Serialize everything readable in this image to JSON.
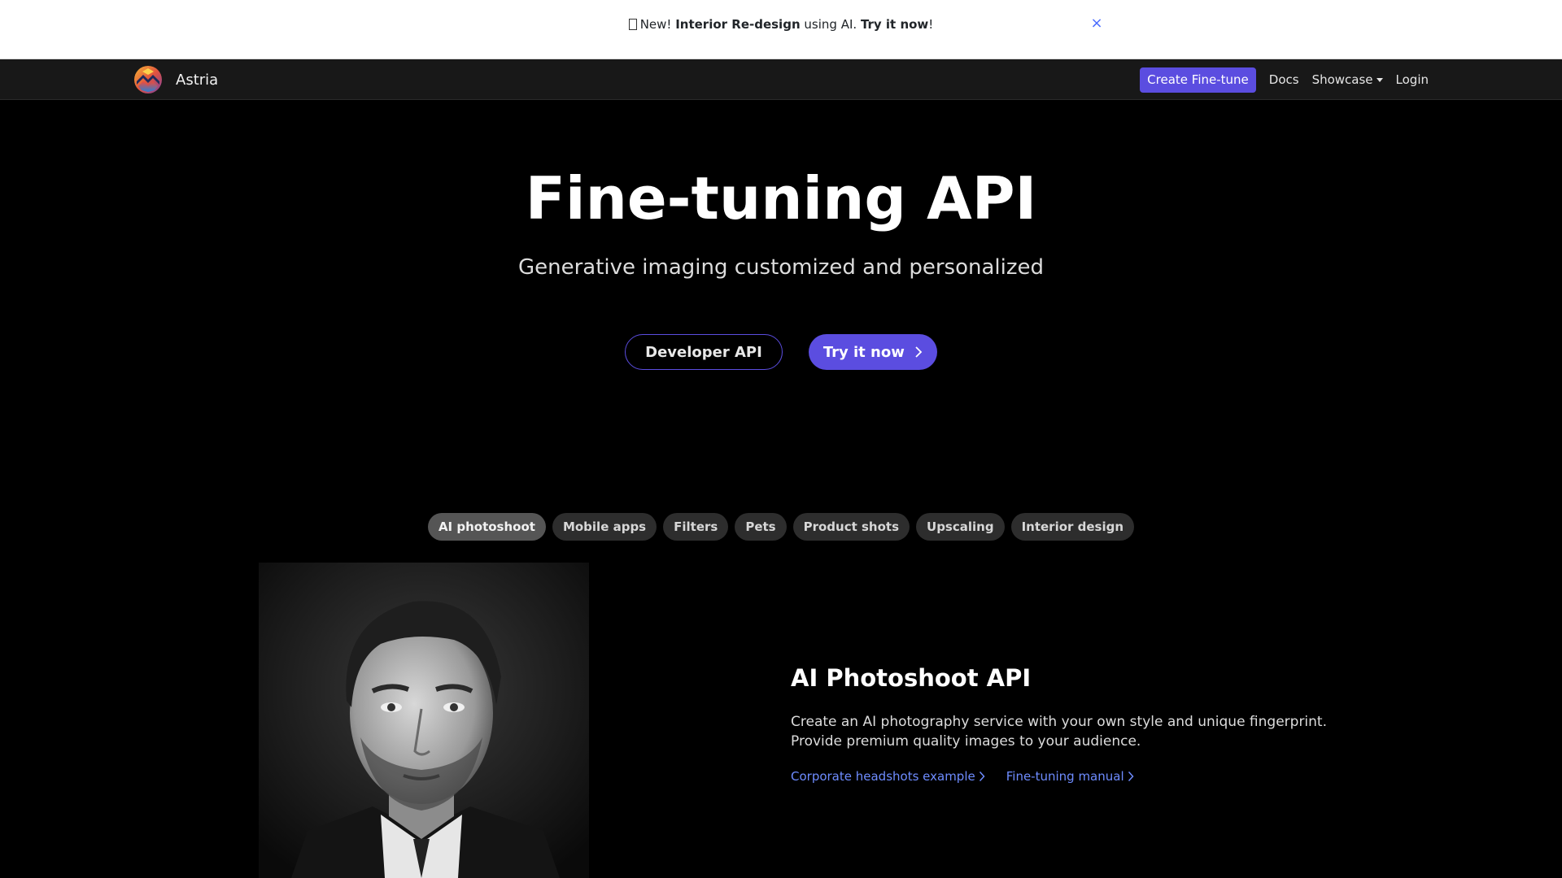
{
  "banner": {
    "prefix": "New!",
    "highlight": "Interior Re-design",
    "middle": "using AI.",
    "cta": "Try it now",
    "suffix": "!",
    "close_icon": "close-icon"
  },
  "navbar": {
    "brand_name": "Astria",
    "create_button": "Create Fine-tune",
    "links": {
      "docs": "Docs",
      "showcase": "Showcase",
      "login": "Login"
    }
  },
  "hero": {
    "title": "Fine-tuning API",
    "subtitle": "Generative imaging customized and personalized",
    "developer_button": "Developer API",
    "try_button": "Try it now"
  },
  "pills": [
    {
      "label": "AI photoshoot",
      "active": true
    },
    {
      "label": "Mobile apps",
      "active": false
    },
    {
      "label": "Filters",
      "active": false
    },
    {
      "label": "Pets",
      "active": false
    },
    {
      "label": "Product shots",
      "active": false
    },
    {
      "label": "Upscaling",
      "active": false
    },
    {
      "label": "Interior design",
      "active": false
    }
  ],
  "feature": {
    "title": "AI Photoshoot API",
    "description": "Create an AI photography service with your own style and unique fingerprint. Provide premium quality images to your audience.",
    "links": {
      "headshots": "Corporate headshots example",
      "manual": "Fine-tuning manual"
    }
  },
  "colors": {
    "accent": "#5b4de0",
    "link": "#6e8cff",
    "background": "#000000",
    "navbar": "#181818"
  }
}
